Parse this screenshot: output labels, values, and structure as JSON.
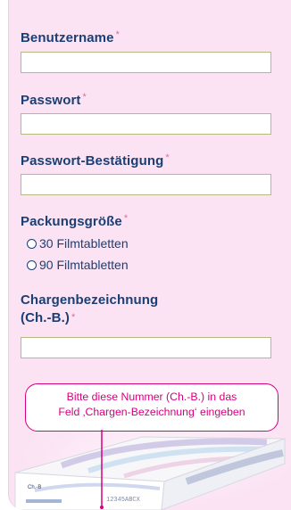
{
  "form": {
    "username_label": "Benutzername",
    "password_label": "Passwort",
    "password_confirm_label": "Passwort-Bestätigung",
    "required_marker": "*",
    "username_value": "",
    "password_value": "",
    "password_confirm_value": "",
    "package_size_label": "Packungsgröße",
    "package_options": [
      "30 Filmtabletten",
      "90 Filmtabletten"
    ],
    "batch_label_line1": "Chargenbezeichnung",
    "batch_label_line2": "(Ch.-B.)",
    "batch_value": ""
  },
  "tooltip": {
    "line1": "Bitte diese Nummer (Ch.-B.) in das",
    "line2": "Feld ‚Chargen-Bezeichnung‘ eingeben"
  },
  "package_art": {
    "label_text": "Ch.-B",
    "number_text": "12345ABCX"
  },
  "colors": {
    "panel_background": "#fbe3f4",
    "label_text": "#1c3f73",
    "required_star": "#d86da7",
    "tooltip_accent": "#d7007e",
    "field_border": "#b7b982"
  }
}
